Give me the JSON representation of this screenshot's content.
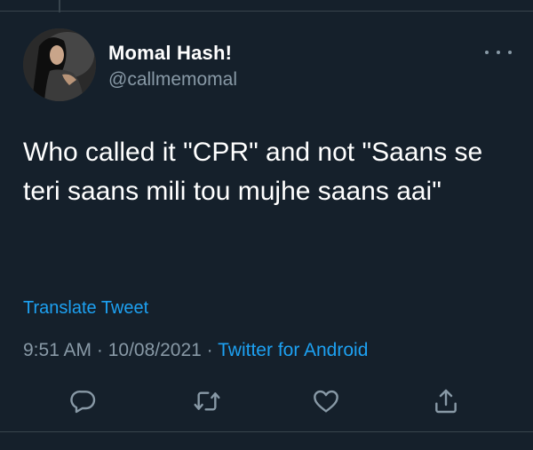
{
  "tweet": {
    "display_name": "Momal Hash!",
    "handle": "@callmemomal",
    "text": "Who called it \"CPR\" and not \"Saans se teri saans mili tou mujhe saans aai\"",
    "translate_label": "Translate Tweet",
    "time": "9:51 AM",
    "separator": " · ",
    "date": "10/08/2021",
    "source": "Twitter for Android"
  },
  "actions": {
    "reply_icon": "reply-icon",
    "retweet_icon": "retweet-icon",
    "like_icon": "heart-icon",
    "share_icon": "share-icon",
    "more_icon": "more-icon"
  },
  "colors": {
    "background": "#15202b",
    "accent": "#1da1f2",
    "secondary_text": "#8899a6",
    "border": "#38444d"
  }
}
